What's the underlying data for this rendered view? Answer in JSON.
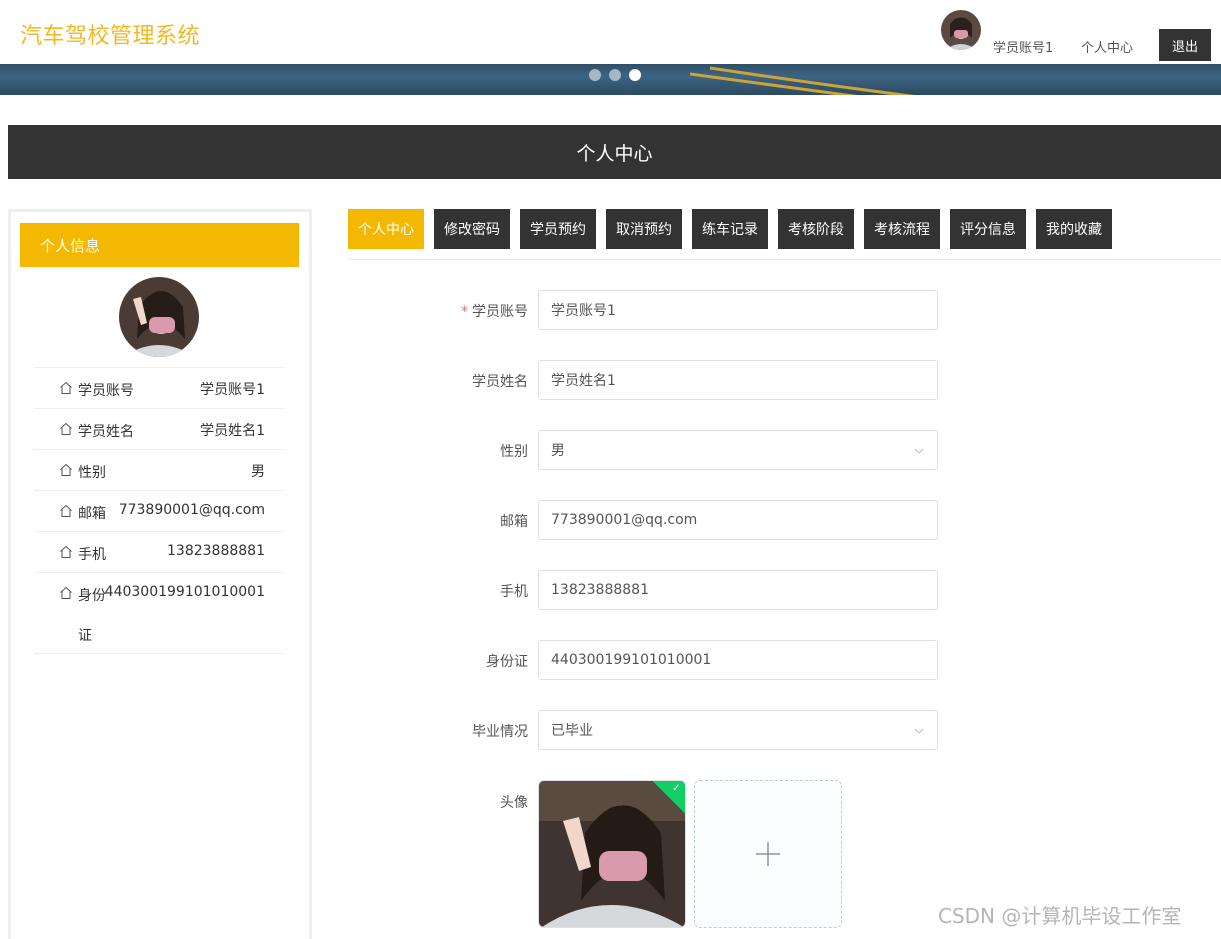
{
  "header": {
    "brand": "汽车驾校管理系统",
    "username": "学员账号1",
    "center_link": "个人中心",
    "logout_label": "退出"
  },
  "banner": {
    "slide_count": 3,
    "active_slide": 3
  },
  "page_title": "个人中心",
  "sidebar": {
    "heading": "个人信息",
    "items": [
      {
        "label": "学员账号",
        "value": "学员账号1"
      },
      {
        "label": "学员姓名",
        "value": "学员姓名1"
      },
      {
        "label": "性别",
        "value": "男"
      },
      {
        "label": "邮箱",
        "value": "773890001@qq.com"
      },
      {
        "label": "手机",
        "value": "13823888881"
      },
      {
        "label": "身份",
        "label_cont": "证",
        "value": "440300199101010001"
      }
    ]
  },
  "tabs": [
    {
      "label": "个人中心",
      "active": true
    },
    {
      "label": "修改密码"
    },
    {
      "label": "学员预约"
    },
    {
      "label": "取消预约"
    },
    {
      "label": "练车记录"
    },
    {
      "label": "考核阶段"
    },
    {
      "label": "考核流程"
    },
    {
      "label": "评分信息"
    },
    {
      "label": "我的收藏"
    }
  ],
  "form": {
    "account": {
      "label": "学员账号",
      "value": "学员账号1",
      "required_mark": "*"
    },
    "name": {
      "label": "学员姓名",
      "value": "学员姓名1"
    },
    "gender": {
      "label": "性别",
      "value": "男"
    },
    "email": {
      "label": "邮箱",
      "value": "773890001@qq.com"
    },
    "phone": {
      "label": "手机",
      "value": "13823888881"
    },
    "id_card": {
      "label": "身份证",
      "value": "440300199101010001"
    },
    "graduation": {
      "label": "毕业情况",
      "value": "已毕业"
    },
    "avatar": {
      "label": "头像",
      "add_symbol": "+"
    }
  },
  "watermark": "CSDN @计算机毕设工作室",
  "colors": {
    "accent": "#f5b800",
    "brand_text": "#f2b824",
    "dark": "#333333",
    "success": "#13ce66"
  }
}
